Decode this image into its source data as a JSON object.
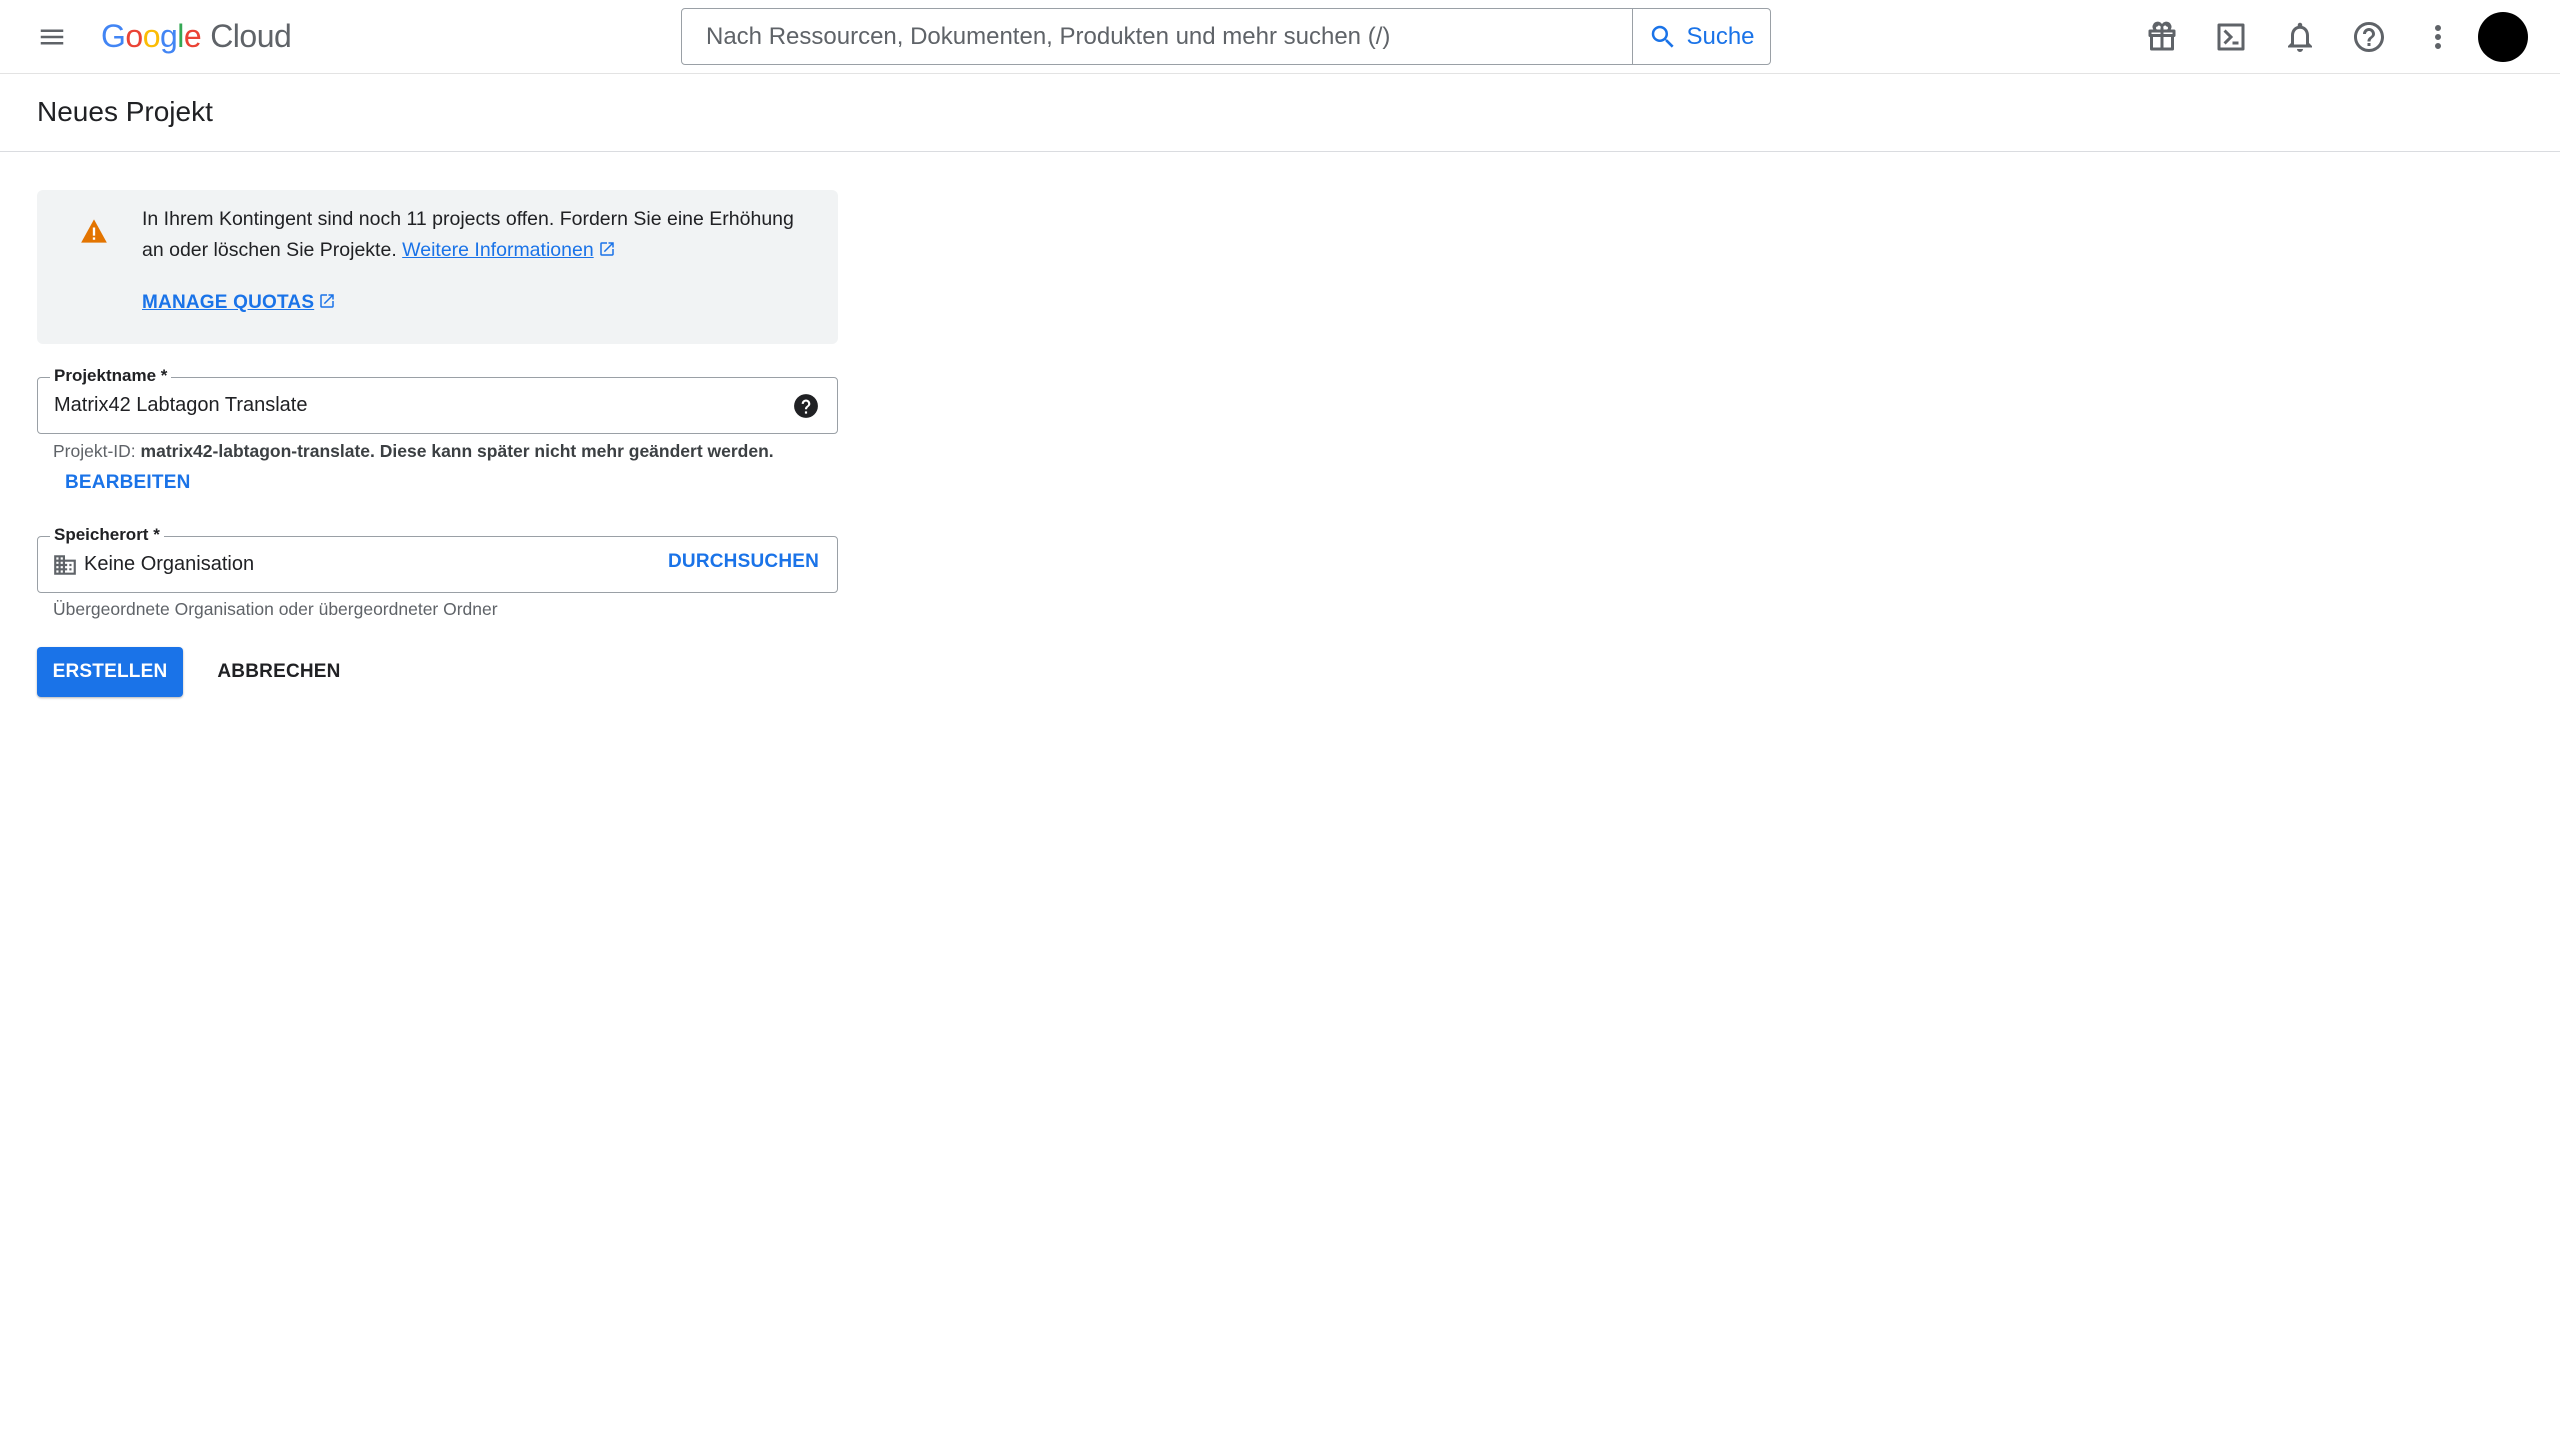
{
  "header": {
    "logo_letters": [
      "G",
      "o",
      "o",
      "g",
      "l",
      "e"
    ],
    "logo_suffix": "Cloud",
    "search_placeholder": "Nach Ressourcen, Dokumenten, Produkten und mehr suchen (/)",
    "search_button": "Suche",
    "icons": [
      "menu-icon",
      "gift-icon",
      "terminal-icon",
      "bell-icon",
      "help-circle-icon",
      "more-vert-icon"
    ]
  },
  "page": {
    "title": "Neues Projekt"
  },
  "notice": {
    "text": "In Ihrem Kontingent sind noch 11 projects offen. Fordern Sie eine Erhöhung an oder löschen Sie Projekte.",
    "more_info_link": "Weitere Informationen",
    "manage_quotas": "MANAGE QUOTAS",
    "warning_color": "#e37400"
  },
  "form": {
    "project_name_label": "Projektname *",
    "project_name_value": "Matrix42 Labtagon Translate",
    "project_id_prefix": "Projekt-ID:",
    "project_id_value": "matrix42-labtagon-translate.",
    "project_id_suffix": "Diese kann später nicht mehr geändert werden.",
    "edit_button": "BEARBEITEN",
    "location_label": "Speicherort *",
    "location_value": "Keine Organisation",
    "browse_button": "DURCHSUCHEN",
    "location_hint": "Übergeordnete Organisation oder übergeordneter Ordner"
  },
  "actions": {
    "create": "ERSTELLEN",
    "cancel": "ABBRECHEN"
  },
  "colors": {
    "accent": "#1a73e8"
  }
}
